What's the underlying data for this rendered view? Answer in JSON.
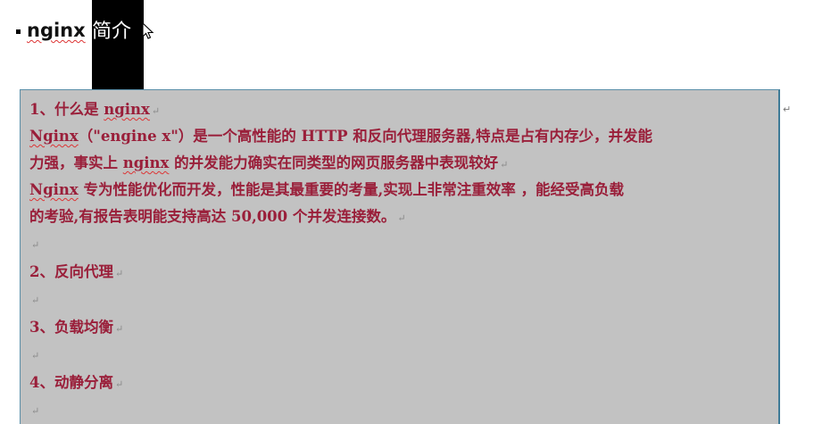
{
  "heading": {
    "latin": "nginx",
    "cjk": "简介"
  },
  "paragraph_mark": "↵",
  "side_mark": "↵",
  "sections": {
    "s1_title_prefix": "1、什么是 ",
    "s1_title_word": "nginx",
    "p1_word": "Nginx",
    "p1_line1_rest": "（\"engine x\"）是一个高性能的 HTTP 和反向代理服务器,特点是占有内存少，并发能",
    "p1_line2_a": "力强，事实上 ",
    "p1_line2_word": "nginx",
    "p1_line2_b": " 的并发能力确实在同类型的网页服务器中表现较好",
    "p2_word": "Nginx",
    "p2_line1_rest": " 专为性能优化而开发，性能是其最重要的考量,实现上非常注重效率 ，能经受高负载",
    "p2_line2": "的考验,有报告表明能支持高达 50,000 个并发连接数。",
    "s2_title": "2、反向代理",
    "s3_title": "3、负载均衡",
    "s4_title": "4、动静分离"
  }
}
